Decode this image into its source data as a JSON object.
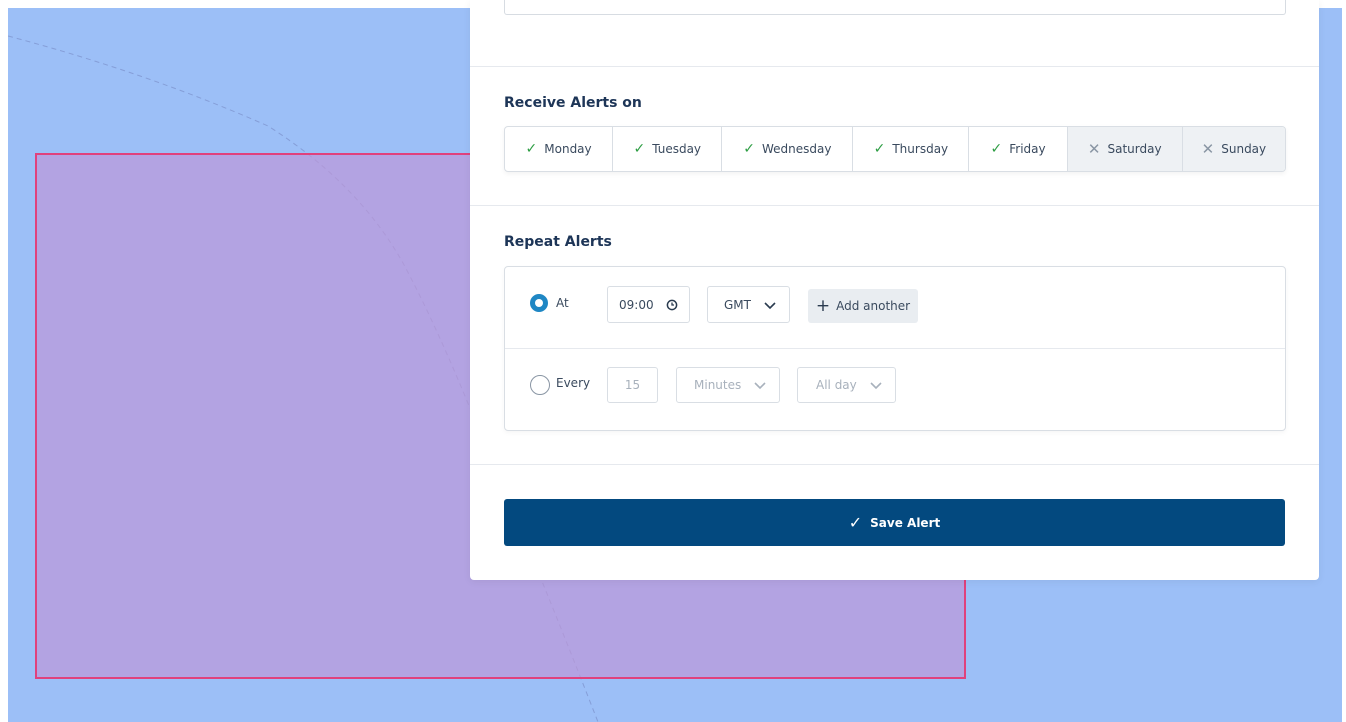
{
  "sections": {
    "receive_title": "Receive Alerts on",
    "repeat_title": "Repeat Alerts"
  },
  "days": [
    {
      "label": "Monday",
      "selected": true
    },
    {
      "label": "Tuesday",
      "selected": true
    },
    {
      "label": "Wednesday",
      "selected": true
    },
    {
      "label": "Thursday",
      "selected": true
    },
    {
      "label": "Friday",
      "selected": true
    },
    {
      "label": "Saturday",
      "selected": false
    },
    {
      "label": "Sunday",
      "selected": false
    }
  ],
  "repeat": {
    "at": {
      "label": "At",
      "selected": true,
      "time": "09:00",
      "timezone": "GMT",
      "add_label": "Add another"
    },
    "every": {
      "label": "Every",
      "selected": false,
      "interval": "15",
      "unit": "Minutes",
      "period": "All day"
    }
  },
  "save_label": "Save Alert",
  "icons": {
    "day_on": "check-icon",
    "day_off": "x-icon",
    "clock": "clock-icon",
    "chevron": "chevron-down-icon",
    "plus": "plus-icon"
  },
  "colors": {
    "map_background": "#9cbff7",
    "region_fill": "#b89fd9",
    "region_border": "#e0417d",
    "check_green": "#2e9e44",
    "radio_blue": "#1f87c4",
    "save_button": "#03497f",
    "heading": "#1d3557"
  }
}
